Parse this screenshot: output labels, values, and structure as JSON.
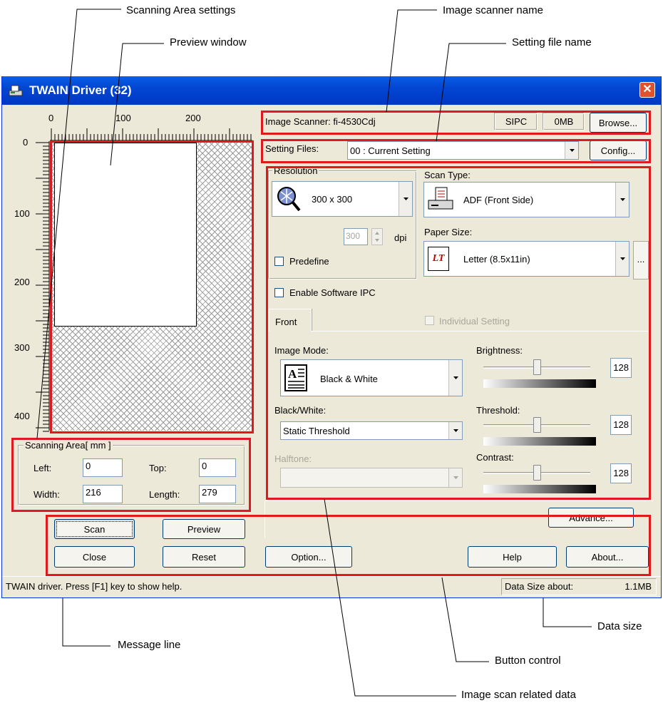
{
  "callouts": {
    "scanning_area_settings": "Scanning Area settings",
    "preview_window": "Preview window",
    "image_scanner_name": "Image scanner name",
    "setting_file_name": "Setting file name",
    "message_line": "Message line",
    "data_size": "Data size",
    "button_control": "Button control",
    "image_scan_related_data": "Image scan related data"
  },
  "window": {
    "title": "TWAIN Driver (32)",
    "close_glyph": "✕"
  },
  "ruler": {
    "x_ticks": [
      "0",
      "100",
      "200"
    ],
    "y_ticks": [
      "0",
      "100",
      "200",
      "300",
      "400"
    ]
  },
  "scanner": {
    "label": "Image Scanner:",
    "name": "fi-4530Cdj",
    "ipc": "SIPC",
    "memory": "0MB",
    "browse_label": "Browse..."
  },
  "setting_files": {
    "label": "Setting Files:",
    "value": "00 : Current Setting",
    "config_label": "Config..."
  },
  "resolution": {
    "group_label": "Resolution",
    "value": "300 x 300",
    "dpi_value": "300",
    "dpi_unit": "dpi",
    "predefine_label": "Predefine",
    "predefine_checked": false
  },
  "scan_type": {
    "label": "Scan Type:",
    "value": "ADF (Front Side)"
  },
  "paper_size": {
    "label": "Paper Size:",
    "value": "Letter (8.5x11in)",
    "more_label": "...",
    "icon_text": "LT"
  },
  "software_ipc": {
    "label": "Enable Software IPC",
    "checked": false
  },
  "tabs": {
    "front": "Front",
    "individual_setting": "Individual Setting"
  },
  "image_mode": {
    "label": "Image Mode:",
    "value": "Black & White"
  },
  "black_white": {
    "label": "Black/White:",
    "value": "Static Threshold"
  },
  "halftone": {
    "label": "Halftone:",
    "value": ""
  },
  "brightness": {
    "label": "Brightness:",
    "value": "128",
    "level": 0.5
  },
  "threshold": {
    "label": "Threshold:",
    "value": "128",
    "level": 0.5
  },
  "contrast": {
    "label": "Contrast:",
    "value": "128",
    "level": 0.5
  },
  "scanning_area": {
    "group_label": "Scanning Area[ mm ]",
    "left_label": "Left:",
    "left_value": "0",
    "top_label": "Top:",
    "top_value": "0",
    "width_label": "Width:",
    "width_value": "216",
    "length_label": "Length:",
    "length_value": "279"
  },
  "buttons": {
    "scan": "Scan",
    "preview": "Preview",
    "close": "Close",
    "reset": "Reset",
    "option": "Option...",
    "help": "Help",
    "about": "About...",
    "advance": "Advance..."
  },
  "status": {
    "message": "TWAIN driver. Press [F1] key to show help.",
    "data_size_label": "Data Size about:",
    "data_size_value": "1.1MB"
  },
  "colors": {
    "highlight": "#e0191e",
    "titlebar": "#0246d2",
    "window_bg": "#ece9d8"
  }
}
